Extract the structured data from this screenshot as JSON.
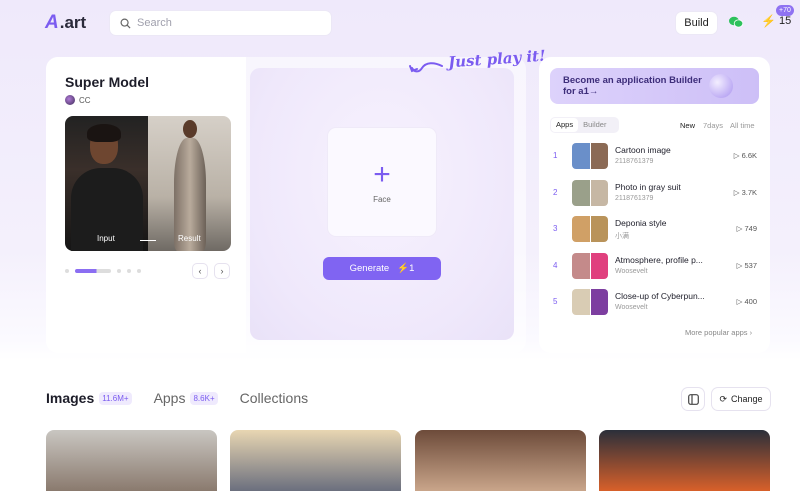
{
  "header": {
    "logo_text": ".art",
    "search_placeholder": "Search",
    "build_label": "Build",
    "credits": "15",
    "credits_badge": "+70"
  },
  "model": {
    "title": "Super Model",
    "author": "CC",
    "input_label": "Input",
    "result_label": "Result"
  },
  "playground": {
    "hint": "Just play it!",
    "face_label": "Face",
    "generate_label": "Generate",
    "generate_cost": "1"
  },
  "apps_panel": {
    "banner_text": "Become an application Builder for a1→",
    "tabs": [
      "Apps",
      "Builder"
    ],
    "sort": [
      "New",
      "7days",
      "All time"
    ],
    "apps": [
      {
        "rank": "1",
        "name": "Cartoon image",
        "author": "2118761379",
        "plays": "6.6K",
        "colors": [
          "#6a8fc9",
          "#8b6a55"
        ]
      },
      {
        "rank": "2",
        "name": "Photo in gray suit",
        "author": "2118761379",
        "plays": "3.7K",
        "colors": [
          "#9aa08a",
          "#c6b7a4"
        ]
      },
      {
        "rank": "3",
        "name": "Deponia style",
        "author": "小满",
        "plays": "749",
        "colors": [
          "#d0a066",
          "#b9935a"
        ]
      },
      {
        "rank": "4",
        "name": "Atmosphere, profile p...",
        "author": "Woosevelt",
        "plays": "537",
        "colors": [
          "#c48a8a",
          "#e0407e"
        ]
      },
      {
        "rank": "5",
        "name": "Close-up of Cyberpun...",
        "author": "Woosevelt",
        "plays": "400",
        "colors": [
          "#d9ccb4",
          "#7d3ea0"
        ]
      }
    ],
    "more_label": "More popular apps"
  },
  "sections": {
    "tabs": [
      {
        "label": "Images",
        "count": "11.6M+"
      },
      {
        "label": "Apps",
        "count": "8.6K+"
      },
      {
        "label": "Collections",
        "count": ""
      }
    ],
    "change_label": "Change"
  },
  "gallery": [
    {
      "colors": [
        "#c9c6c1",
        "#8a7a6e"
      ]
    },
    {
      "colors": [
        "#e8d6b2",
        "#6b6f7e"
      ]
    },
    {
      "colors": [
        "#6d4b3a",
        "#c9a58a"
      ]
    },
    {
      "colors": [
        "#2b2f3a",
        "#d8602a"
      ]
    }
  ]
}
